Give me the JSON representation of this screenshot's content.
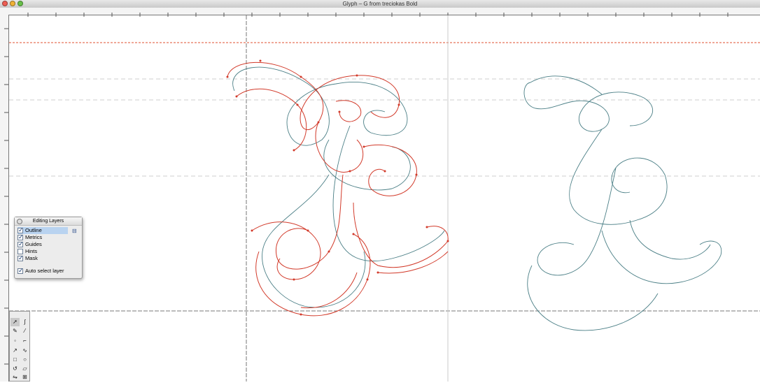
{
  "window": {
    "title": "Glyph – G from treciokas Bold"
  },
  "editing_layers": {
    "title": "Editing Layers",
    "layers": [
      {
        "label": "Outline",
        "checked": true,
        "selected": true
      },
      {
        "label": "Metrics",
        "checked": true,
        "selected": false
      },
      {
        "label": "Guides",
        "checked": true,
        "selected": false
      },
      {
        "label": "Hints",
        "checked": false,
        "selected": false
      },
      {
        "label": "Mask",
        "checked": true,
        "selected": false
      }
    ],
    "auto_select": {
      "label": "Auto select layer",
      "checked": true
    }
  },
  "tools": [
    {
      "icon": "pointer-icon"
    },
    {
      "icon": "freehand-icon"
    },
    {
      "icon": "pen-icon"
    },
    {
      "icon": "knife-icon"
    },
    {
      "icon": "curve-point-icon"
    },
    {
      "icon": "corner-point-icon"
    },
    {
      "icon": "tangent-point-icon"
    },
    {
      "icon": "spiro-icon"
    },
    {
      "icon": "rectangle-icon"
    },
    {
      "icon": "ellipse-icon"
    },
    {
      "icon": "rotate-icon"
    },
    {
      "icon": "skew-icon"
    },
    {
      "icon": "flip-icon"
    },
    {
      "icon": "perspective-icon"
    }
  ],
  "colors": {
    "outline": "#d23a2a",
    "background_outline": "#4b7f86",
    "guide": "#e05030"
  }
}
